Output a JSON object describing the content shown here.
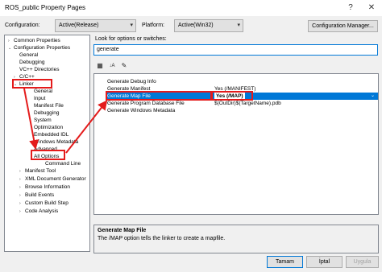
{
  "window": {
    "title": "ROS_public Property Pages",
    "help_glyph": "?",
    "close_glyph": "✕"
  },
  "config": {
    "configuration_label": "Configuration:",
    "configuration_value": "Active(Release)",
    "platform_label": "Platform:",
    "platform_value": "Active(Win32)",
    "manager_button": "Configuration Manager..."
  },
  "tree": [
    {
      "label": "Common Properties",
      "toggle": "›"
    },
    {
      "label": "Configuration Properties",
      "toggle": "⌄"
    },
    {
      "label": "General",
      "toggle": ""
    },
    {
      "label": "Debugging",
      "toggle": ""
    },
    {
      "label": "VC++ Directories",
      "toggle": ""
    },
    {
      "label": "C/C++",
      "toggle": "›"
    },
    {
      "label": "Linker",
      "toggle": "⌄"
    },
    {
      "label": "General",
      "toggle": ""
    },
    {
      "label": "Input",
      "toggle": ""
    },
    {
      "label": "Manifest File",
      "toggle": ""
    },
    {
      "label": "Debugging",
      "toggle": ""
    },
    {
      "label": "System",
      "toggle": ""
    },
    {
      "label": "Optimization",
      "toggle": ""
    },
    {
      "label": "Embedded IDL",
      "toggle": ""
    },
    {
      "label": "Windows Metadata",
      "toggle": ""
    },
    {
      "label": "Advanced",
      "toggle": ""
    },
    {
      "label": "All Options",
      "toggle": ""
    },
    {
      "label": "Command Line",
      "toggle": ""
    },
    {
      "label": "Manifest Tool",
      "toggle": "›"
    },
    {
      "label": "XML Document Generator",
      "toggle": "›"
    },
    {
      "label": "Browse Information",
      "toggle": "›"
    },
    {
      "label": "Build Events",
      "toggle": "›"
    },
    {
      "label": "Custom Build Step",
      "toggle": "›"
    },
    {
      "label": "Code Analysis",
      "toggle": "›"
    }
  ],
  "search": {
    "label": "Look for options or switches:",
    "value": "generate"
  },
  "toolbar": {
    "categorized_icon": "▦",
    "alpha_icon": "↓A",
    "pages_icon": "✎"
  },
  "grid": {
    "rows": [
      {
        "name": "Generate Debug Info",
        "value": ""
      },
      {
        "name": "Generate Manifest",
        "value": "Yes (/MANIFEST)"
      },
      {
        "name": "Generate Map File",
        "value": "Yes (/MAP)"
      },
      {
        "name": "Generate Program Database File",
        "value": "$(OutDir)$(TargetName).pdb"
      },
      {
        "name": "Generate Windows Metadata",
        "value": ""
      }
    ],
    "dropdown_glyph": "⌄"
  },
  "description": {
    "title": "Generate Map File",
    "text": "The /MAP option tells the linker to create a mapfile."
  },
  "buttons": {
    "ok": "Tamam",
    "cancel": "İptal",
    "apply": "Uygula"
  },
  "colors": {
    "selection": "#0078d7",
    "annotation": "#e41b1b"
  }
}
